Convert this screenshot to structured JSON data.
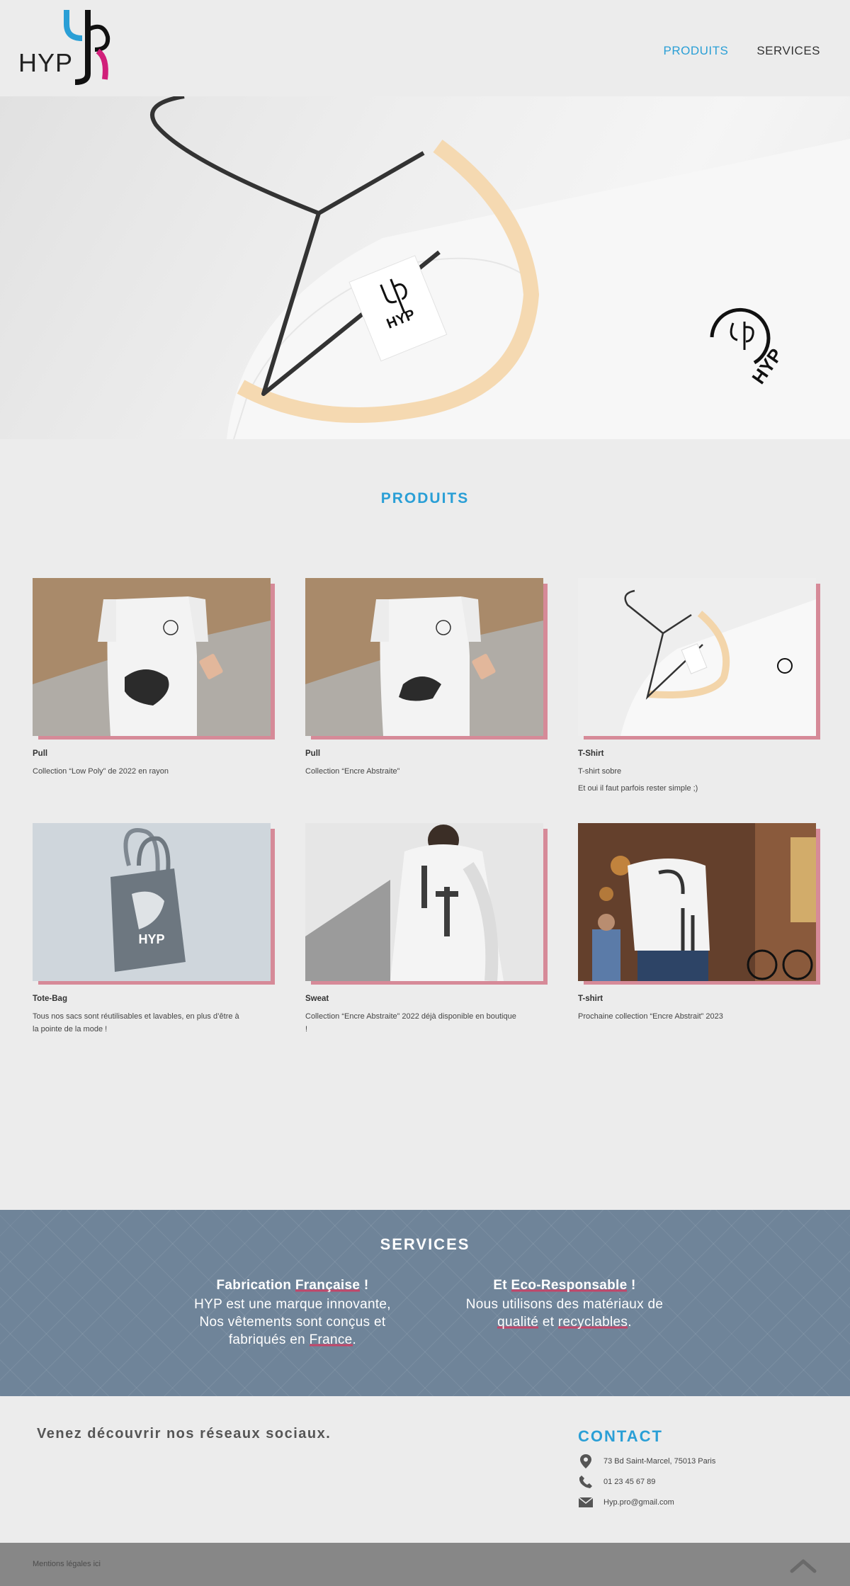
{
  "header": {
    "logo_text": "HYP",
    "nav": [
      {
        "label": "PRODUITS",
        "active": true
      },
      {
        "label": "SERVICES",
        "active": false
      }
    ]
  },
  "hero": {
    "label_text": "HYP",
    "print_text": "HYP"
  },
  "products": {
    "title": "PRODUITS",
    "items": [
      {
        "title": "Pull",
        "lines": [
          "Collection “Low Poly” de 2022 en rayon"
        ]
      },
      {
        "title": "Pull",
        "lines": [
          "Collection “Encre Abstraite”"
        ]
      },
      {
        "title": "T-Shirt",
        "lines": [
          "T-shirt sobre",
          "Et oui il faut parfois rester simple ;)"
        ]
      },
      {
        "title": "Tote-Bag",
        "lines": [
          "Tous nos sacs sont réutilisables et lavables, en plus d’être à la pointe de la mode !"
        ]
      },
      {
        "title": "Sweat",
        "lines": [
          "Collection “Encre Abstraite” 2022 déjà disponible en boutique !"
        ]
      },
      {
        "title": "T-shirt",
        "lines": [
          "Prochaine collection “Encre Abstrait” 2023"
        ]
      }
    ],
    "tote_print_text": "HYP"
  },
  "services": {
    "title": "SERVICES",
    "col1": {
      "head_a": "Fabrication ",
      "head_b": "Française",
      "head_c": " !",
      "line1": "HYP est une marque innovante,",
      "line2": "Nos vêtements sont conçus et",
      "line3a": "fabriqués en ",
      "line3b": "France",
      "line3c": "."
    },
    "col2": {
      "head_a": "Et ",
      "head_b": "Eco-Responsable",
      "head_c": " !",
      "line1": "Nous utilisons des matériaux de",
      "line2a": "qualité",
      "line2b": " et ",
      "line2c": "recyclables",
      "line2d": "."
    }
  },
  "footer": {
    "social_text": "Venez découvrir nos réseaux sociaux.",
    "contact_title": "CONTACT",
    "address": "73 Bd Saint-Marcel, 75013 Paris",
    "phone": "01 23 45 67 89",
    "email": "Hyp.pro@gmail.com",
    "legal": "Mentions légales ici"
  },
  "colors": {
    "accent": "#2a9fd6",
    "pink": "#d68a98",
    "services_bg": "#6f8499",
    "underline": "#c2476a"
  },
  "icons": [
    "location-pin-icon",
    "phone-icon",
    "mail-icon",
    "chevron-up-icon"
  ]
}
